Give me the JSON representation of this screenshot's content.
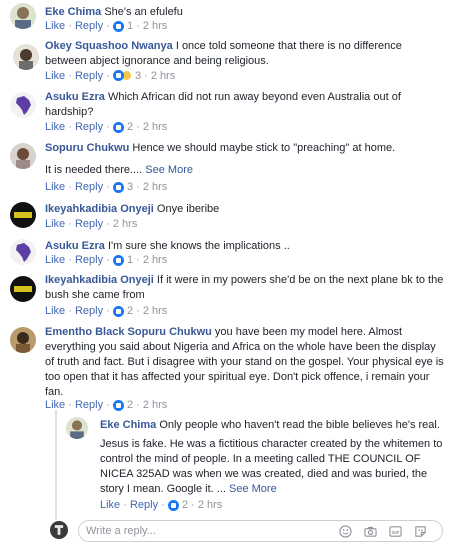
{
  "comments": [
    {
      "name": "Eke Chima",
      "text": "She's an efulefu",
      "like": "Like",
      "reply": "Reply",
      "count": "1",
      "time": "2 hrs",
      "avatar": "photo-avatar"
    },
    {
      "name": "Okey Squashoo Nwanya",
      "text": "I once told someone that there is no difference between abject ignorance and being religious.",
      "like": "Like",
      "reply": "Reply",
      "count": "3",
      "time": "2 hrs",
      "avatar": "photo-avatar"
    },
    {
      "name": "Asuku Ezra",
      "text": "Which African did not run away beyond even Australia out of hardship?",
      "like": "Like",
      "reply": "Reply",
      "count": "2",
      "time": "2 hrs",
      "avatar": "africa-map-avatar"
    },
    {
      "name": "Sopuru Chukwu",
      "text": "Hence we should maybe stick to \"preaching\" at home.",
      "text2": "It is needed there....",
      "more": "See More",
      "like": "Like",
      "reply": "Reply",
      "count": "3",
      "time": "2 hrs",
      "avatar": "photo-avatar"
    },
    {
      "name": "Ikeyahkadibia Onyeji",
      "text": "Onye iberibe",
      "like": "Like",
      "reply": "Reply",
      "count": "",
      "time": "2 hrs",
      "avatar": "badge-avatar"
    },
    {
      "name": "Asuku Ezra",
      "text": "I'm sure she knows the implications ..",
      "like": "Like",
      "reply": "Reply",
      "count": "1",
      "time": "2 hrs",
      "avatar": "africa-map-avatar"
    },
    {
      "name": "Ikeyahkadibia Onyeji",
      "text": "If it were in my powers she'd be on the next plane bk to the bush she came from",
      "like": "Like",
      "reply": "Reply",
      "count": "2",
      "time": "2 hrs",
      "avatar": "badge-avatar"
    },
    {
      "name": "Ementho Black",
      "mention": "Sopuru Chukwu",
      "text": "you have been my model here. Almost everything you said about Nigeria and Africa on the whole have been the display of truth and fact. But i disagree with your stand on the gospel. Your physical eye is too open that it has affected your spiritual eye. Don't pick offence, i remain your fan.",
      "like": "Like",
      "reply": "Reply",
      "count": "2",
      "time": "2 hrs",
      "avatar": "photo-avatar"
    }
  ],
  "reply": {
    "name": "Eke Chima",
    "text": "Only people who haven't read the bible believes he's real.",
    "text2": "Jesus is fake. He was a fictitious character created by the whitemen to control the mind of people. In a meeting called THE COUNCIL OF NICEA 325AD was when we was created, died and was buried, the story I mean. Google it. ...",
    "more": "See More",
    "like": "Like",
    "reply": "Reply",
    "count": "2",
    "time": "2 hrs"
  },
  "composer": {
    "placeholder": "Write a reply..."
  },
  "icons": [
    "emoji-icon",
    "camera-icon",
    "gif-icon",
    "sticker-icon"
  ],
  "colors": {
    "name": "#385898",
    "link": "#4267b2",
    "meta": "#90949c",
    "text": "#1d2129"
  }
}
